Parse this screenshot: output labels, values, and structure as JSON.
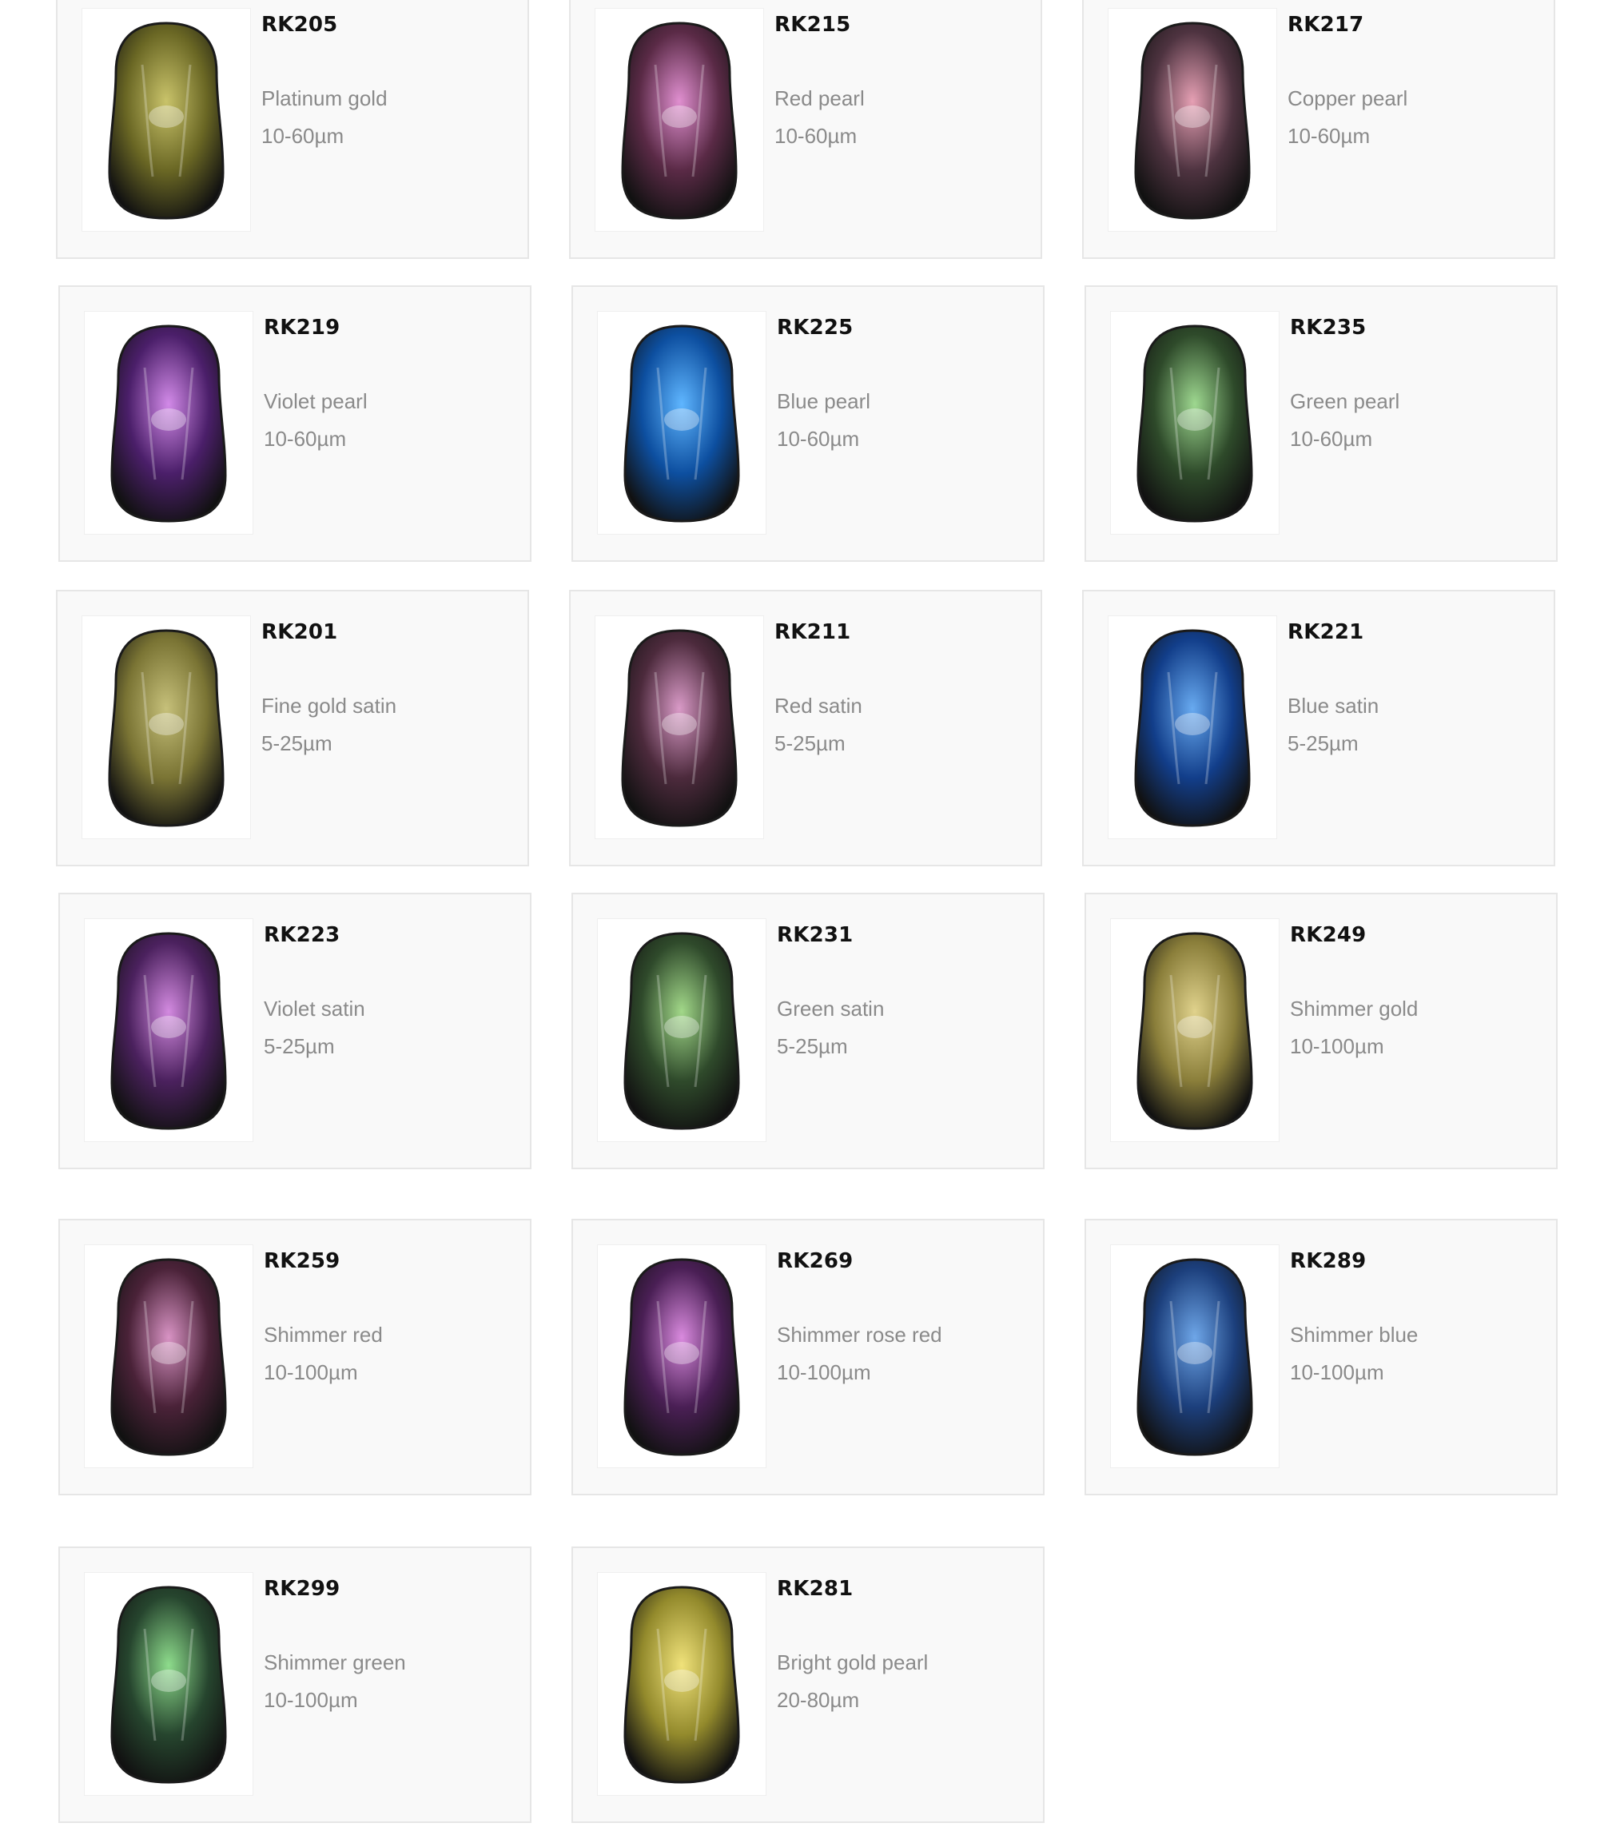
{
  "products": [
    {
      "code": "RK205",
      "name": "Platinum gold",
      "size": "10-60µm",
      "color": "#6a6724",
      "highlight": "#c9c36a"
    },
    {
      "code": "RK215",
      "name": "Red pearl",
      "size": "10-60µm",
      "color": "#5a2a46",
      "highlight": "#e08fd0"
    },
    {
      "code": "RK217",
      "name": "Copper pearl",
      "size": "10-60µm",
      "color": "#4e3340",
      "highlight": "#e6a0b4"
    },
    {
      "code": "RK219",
      "name": "Violet pearl",
      "size": "10-60µm",
      "color": "#4b1f6a",
      "highlight": "#d28ae8"
    },
    {
      "code": "RK225",
      "name": "Blue pearl",
      "size": "10-60µm",
      "color": "#0d4fa0",
      "highlight": "#5fb6ff"
    },
    {
      "code": "RK235",
      "name": "Green pearl",
      "size": "10-60µm",
      "color": "#2e4a2a",
      "highlight": "#9ed890"
    },
    {
      "code": "RK201",
      "name": "Fine gold satin",
      "size": "5-25µm",
      "color": "#7a7434",
      "highlight": "#c6c07a"
    },
    {
      "code": "RK211",
      "name": "Red satin",
      "size": "5-25µm",
      "color": "#4c2a3c",
      "highlight": "#d99ac7"
    },
    {
      "code": "RK221",
      "name": "Blue satin",
      "size": "5-25µm",
      "color": "#123e8a",
      "highlight": "#68aaf0"
    },
    {
      "code": "RK223",
      "name": "Violet satin",
      "size": "5-25µm",
      "color": "#4b215e",
      "highlight": "#d38ae0"
    },
    {
      "code": "RK231",
      "name": "Green satin",
      "size": "5-25µm",
      "color": "#2f4a2b",
      "highlight": "#a2d889"
    },
    {
      "code": "RK249",
      "name": "Shimmer gold",
      "size": "10-100µm",
      "color": "#8a7e3a",
      "highlight": "#e0d28c"
    },
    {
      "code": "RK259",
      "name": "Shimmer red",
      "size": "10-100µm",
      "color": "#4a2238",
      "highlight": "#d893c4"
    },
    {
      "code": "RK269",
      "name": "Shimmer rose red",
      "size": "10-100µm",
      "color": "#4a1f55",
      "highlight": "#d98ade"
    },
    {
      "code": "RK289",
      "name": "Shimmer blue",
      "size": "10-100µm",
      "color": "#1c3f7c",
      "highlight": "#6ea6e8"
    },
    {
      "code": "RK299",
      "name": "Shimmer green",
      "size": "10-100µm",
      "color": "#26452e",
      "highlight": "#8edc8c"
    },
    {
      "code": "RK281",
      "name": "Bright gold pearl",
      "size": "20-80µm",
      "color": "#938a2c",
      "highlight": "#f0e27a"
    }
  ]
}
